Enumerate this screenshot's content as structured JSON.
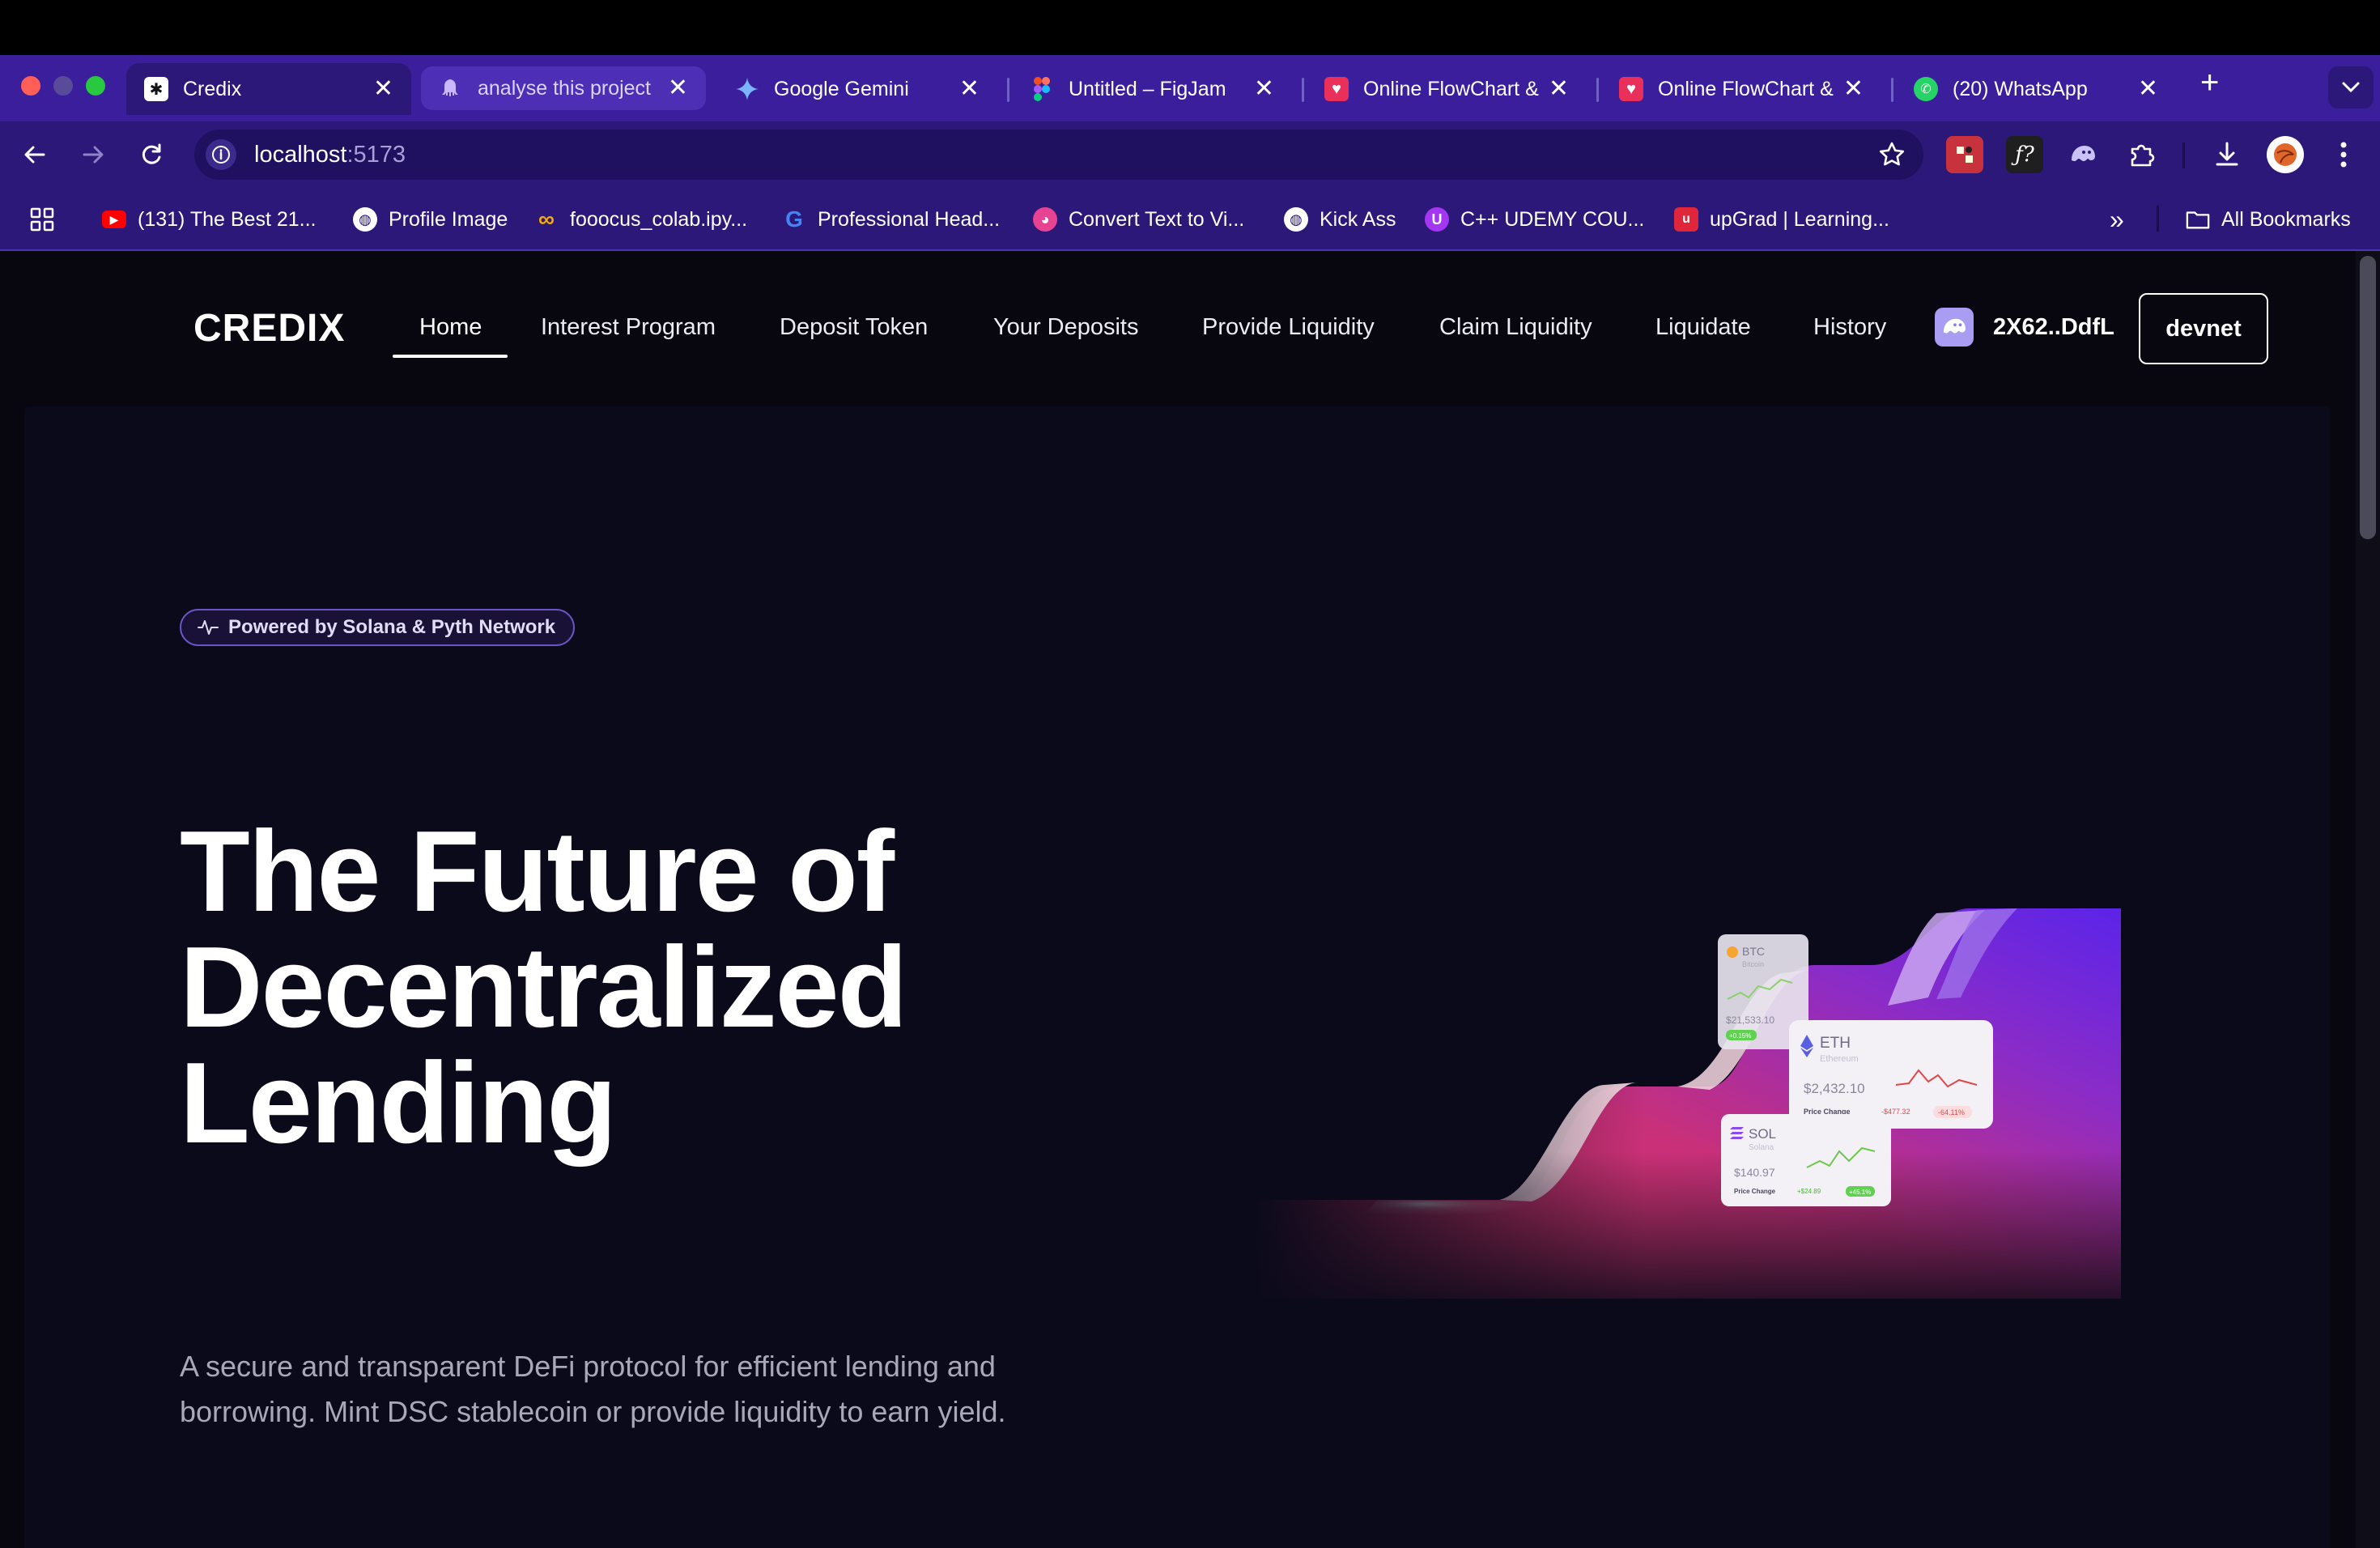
{
  "browser": {
    "tabs": [
      {
        "title": "Credix",
        "icon": "asterisk-icon",
        "active": true
      },
      {
        "title": "analyse this project",
        "icon": "octopus-icon"
      },
      {
        "title": "Google Gemini",
        "icon": "gemini-sparkle-icon"
      },
      {
        "title": "Untitled – FigJam",
        "icon": "figma-icon"
      },
      {
        "title": "Online FlowChart &",
        "icon": "heart-logo-icon"
      },
      {
        "title": "Online FlowChart &",
        "icon": "heart-logo-icon"
      },
      {
        "title": "(20) WhatsApp",
        "icon": "whatsapp-icon"
      }
    ],
    "new_tab": "+",
    "close_glyph": "✕",
    "address": {
      "host": "localhost",
      "port": ":5173"
    },
    "bookmarks": [
      {
        "label": "(131) The Best 21...",
        "icon": "youtube-icon"
      },
      {
        "label": "Profile Image",
        "icon": "globe-icon"
      },
      {
        "label": "fooocus_colab.ipy...",
        "icon": "colab-icon"
      },
      {
        "label": "Professional Head...",
        "icon": "google-icon"
      },
      {
        "label": "Convert Text to Vi...",
        "icon": "pink-logo-icon"
      },
      {
        "label": "Kick Ass",
        "icon": "globe-icon"
      },
      {
        "label": "C++ UDEMY COU...",
        "icon": "udemy-icon"
      },
      {
        "label": "upGrad | Learning...",
        "icon": "upgrad-icon"
      }
    ],
    "more_bookmarks": "»",
    "all_bookmarks": "All Bookmarks",
    "colors": {
      "chrome": "#3a1e9c",
      "toolbar": "#2b1878"
    }
  },
  "site": {
    "logo": "CREDIX",
    "nav": [
      {
        "label": "Home",
        "active": true
      },
      {
        "label": "Interest Program"
      },
      {
        "label": "Deposit Token"
      },
      {
        "label": "Your Deposits"
      },
      {
        "label": "Provide Liquidity"
      },
      {
        "label": "Claim Liquidity"
      },
      {
        "label": "Liquidate"
      },
      {
        "label": "History"
      }
    ],
    "wallet": "2X62..DdfL",
    "network": "devnet",
    "hero": {
      "badge": "Powered by Solana & Pyth Network",
      "headline": [
        "The Future of",
        "Decentralized",
        "Lending"
      ],
      "subtext": "A secure and transparent DeFi protocol for efficient lending and borrowing. Mint DSC stablecoin or provide liquidity to earn yield."
    },
    "cards": {
      "btc": {
        "symbol": "BTC",
        "name": "Bitcoin",
        "price": "$21,533.10",
        "pill": "+0.15%"
      },
      "eth": {
        "symbol": "ETH",
        "name": "Ethereum",
        "price": "$2,432.10",
        "change_label": "Price Change",
        "change": "-$477.32",
        "pill": "-64.11%"
      },
      "sol": {
        "symbol": "SOL",
        "name": "Solana",
        "price": "$140.97",
        "change_label": "Price Change",
        "change": "+$24.89",
        "pill": "+45.1%"
      }
    },
    "colors": {
      "page_bg": "#08070f",
      "hero_bg": "#0b0a1b",
      "accent": "#6b55c4",
      "positive": "#3fcf3f",
      "negative": "#e03a4a"
    }
  }
}
